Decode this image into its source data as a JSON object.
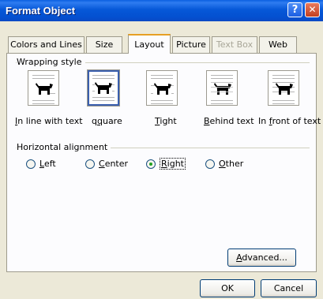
{
  "window": {
    "title": "Format Object",
    "help_glyph": "?",
    "close_glyph": "✕"
  },
  "tabs": [
    {
      "label": "Colors and Lines",
      "state": "normal"
    },
    {
      "label": "Size",
      "state": "normal"
    },
    {
      "label": "Layout",
      "state": "active"
    },
    {
      "label": "Picture",
      "state": "normal"
    },
    {
      "label": "Text Box",
      "state": "disabled"
    },
    {
      "label": "Web",
      "state": "normal"
    }
  ],
  "wrapping_style": {
    "group_label": "Wrapping style",
    "selected": "Square",
    "options": [
      {
        "label": "In line with text",
        "mnemonic_index": 0,
        "icon": "inline-wrap-icon"
      },
      {
        "label": "Square",
        "mnemonic_index": 1,
        "icon": "square-wrap-icon"
      },
      {
        "label": "Tight",
        "mnemonic_index": 0,
        "icon": "tight-wrap-icon"
      },
      {
        "label": "Behind text",
        "mnemonic_index": 0,
        "icon": "behind-text-icon"
      },
      {
        "label": "In front of text",
        "mnemonic_index": 3,
        "icon": "in-front-of-text-icon"
      }
    ]
  },
  "horizontal_alignment": {
    "group_label": "Horizontal alignment",
    "selected": "Right",
    "options": [
      {
        "label": "Left",
        "mnemonic_index": 0
      },
      {
        "label": "Center",
        "mnemonic_index": 0
      },
      {
        "label": "Right",
        "mnemonic_index": 0
      },
      {
        "label": "Other",
        "mnemonic_index": 0
      }
    ]
  },
  "buttons": {
    "advanced": "Advanced...",
    "ok": "OK",
    "cancel": "Cancel"
  },
  "colors": {
    "titlebar": "#0458d8",
    "dialog_bg": "#ece9d8",
    "radio_dot": "#21a121",
    "tab_highlight": "#e6a024"
  }
}
